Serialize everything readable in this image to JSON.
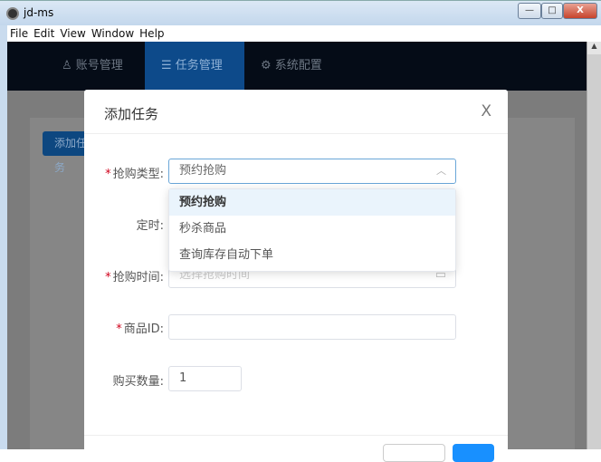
{
  "window": {
    "title": "jd-ms",
    "controls": {
      "minimize": "—",
      "maximize": "□",
      "close": "X"
    }
  },
  "menu": [
    "File",
    "Edit",
    "View",
    "Window",
    "Help"
  ],
  "nav": [
    {
      "label": "账号管理",
      "icon": "user-icon",
      "glyph": "♙"
    },
    {
      "label": "任务管理",
      "icon": "list-icon",
      "glyph": "☰"
    },
    {
      "label": "系统配置",
      "icon": "gear-icon",
      "glyph": "⚙"
    }
  ],
  "page": {
    "add_button": "添加任务"
  },
  "modal": {
    "title": "添加任务",
    "close": "X",
    "fields": {
      "type": {
        "label": "抢购类型:",
        "value": "预约抢购"
      },
      "timer": {
        "label": "定时:"
      },
      "time": {
        "label": "抢购时间:",
        "placeholder": "选择抢购时间"
      },
      "sku": {
        "label": "商品ID:",
        "value": ""
      },
      "qty": {
        "label": "购买数量:",
        "value": "1"
      }
    },
    "dropdown": [
      "预约抢购",
      "秒杀商品",
      "查询库存自动下单"
    ]
  },
  "colors": {
    "accent": "#0d4a8a",
    "primary": "#1890ff",
    "required": "#d0021b"
  }
}
